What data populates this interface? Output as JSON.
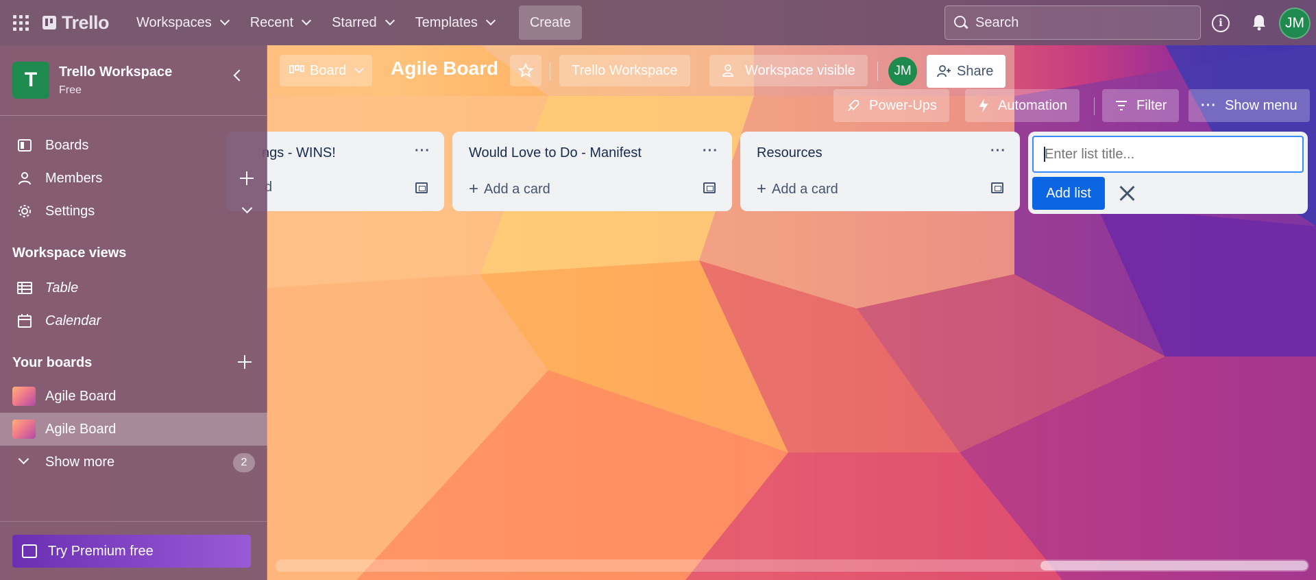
{
  "topbar": {
    "logo": "Trello",
    "nav": [
      {
        "label": "Workspaces"
      },
      {
        "label": "Recent"
      },
      {
        "label": "Starred"
      },
      {
        "label": "Templates"
      }
    ],
    "create_label": "Create",
    "search_placeholder": "Search",
    "avatar_initials": "JM"
  },
  "sidebar": {
    "workspace_name": "Trello Workspace",
    "workspace_plan": "Free",
    "workspace_initial": "T",
    "items": [
      {
        "label": "Boards"
      },
      {
        "label": "Members"
      },
      {
        "label": "Settings"
      }
    ],
    "views_heading": "Workspace views",
    "views": [
      {
        "label": "Table"
      },
      {
        "label": "Calendar"
      }
    ],
    "boards_heading": "Your boards",
    "boards": [
      {
        "label": "Agile Board"
      },
      {
        "label": "Agile Board"
      }
    ],
    "show_more_label": "Show more",
    "show_more_count": "2",
    "premium_label": "Try Premium free"
  },
  "board": {
    "view_label": "Board",
    "title": "Agile Board",
    "workspace_label": "Trello Workspace",
    "visibility_label": "Workspace visible",
    "member_initials": "JM",
    "share_label": "Share",
    "powerups_label": "Power-Ups",
    "automation_label": "Automation",
    "filter_label": "Filter",
    "show_menu_label": "Show menu"
  },
  "lists": [
    {
      "title": "ngs - WINS!",
      "add_card": "d"
    },
    {
      "title": "Would Love to Do - Manifest",
      "add_card": "Add a card"
    },
    {
      "title": "Resources",
      "add_card": "Add a card"
    }
  ],
  "add_list": {
    "placeholder": "Enter list title...",
    "button_label": "Add list"
  },
  "colors": {
    "accent": "#0c66e4",
    "avatar": "#1f8a4e",
    "premium_start": "#6a2fb2",
    "premium_end": "#9a5ad6"
  }
}
